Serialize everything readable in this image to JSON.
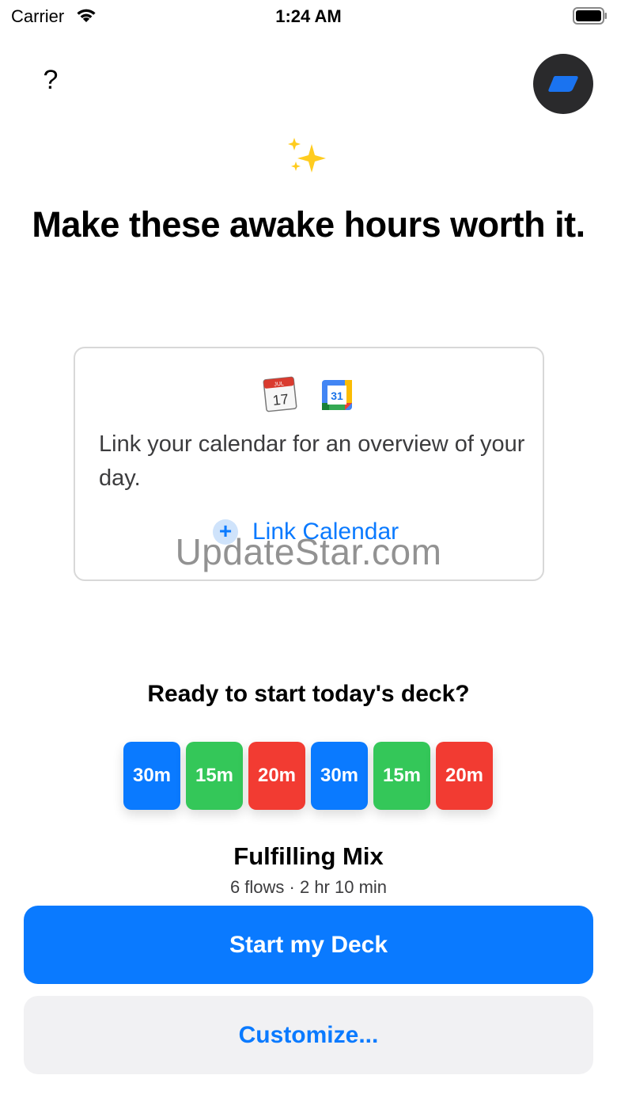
{
  "status_bar": {
    "carrier": "Carrier",
    "time": "1:24 AM",
    "wifi_icon": "wifi-icon",
    "battery_icon": "battery-icon"
  },
  "header": {
    "help_label": "?",
    "profile_icon": "profile-avatar-icon"
  },
  "hero": {
    "icon": "sparkles-icon",
    "headline": "Make these awake hours worth it."
  },
  "calendar_card": {
    "apple_calendar_icon": {
      "month": "JUL",
      "day": "17"
    },
    "google_calendar_icon": {
      "day": "31"
    },
    "text": "Link your calendar for an overview of your day.",
    "link_label": "Link Calendar",
    "link_icon": "plus-circle-icon"
  },
  "watermark": "UpdateStar.com",
  "deck": {
    "title": "Ready to start today's deck?",
    "cards": [
      {
        "label": "30m",
        "color": "#0a7aff"
      },
      {
        "label": "15m",
        "color": "#34c759"
      },
      {
        "label": "20m",
        "color": "#f23b32"
      },
      {
        "label": "30m",
        "color": "#0a7aff"
      },
      {
        "label": "15m",
        "color": "#34c759"
      },
      {
        "label": "20m",
        "color": "#f23b32"
      }
    ],
    "mix_name": "Fulfilling Mix",
    "mix_summary": "6 flows · 2 hr 10 min"
  },
  "actions": {
    "start_label": "Start my Deck",
    "customize_label": "Customize..."
  },
  "colors": {
    "accent": "#0a7aff",
    "secondary_button_bg": "#f1f1f3"
  }
}
